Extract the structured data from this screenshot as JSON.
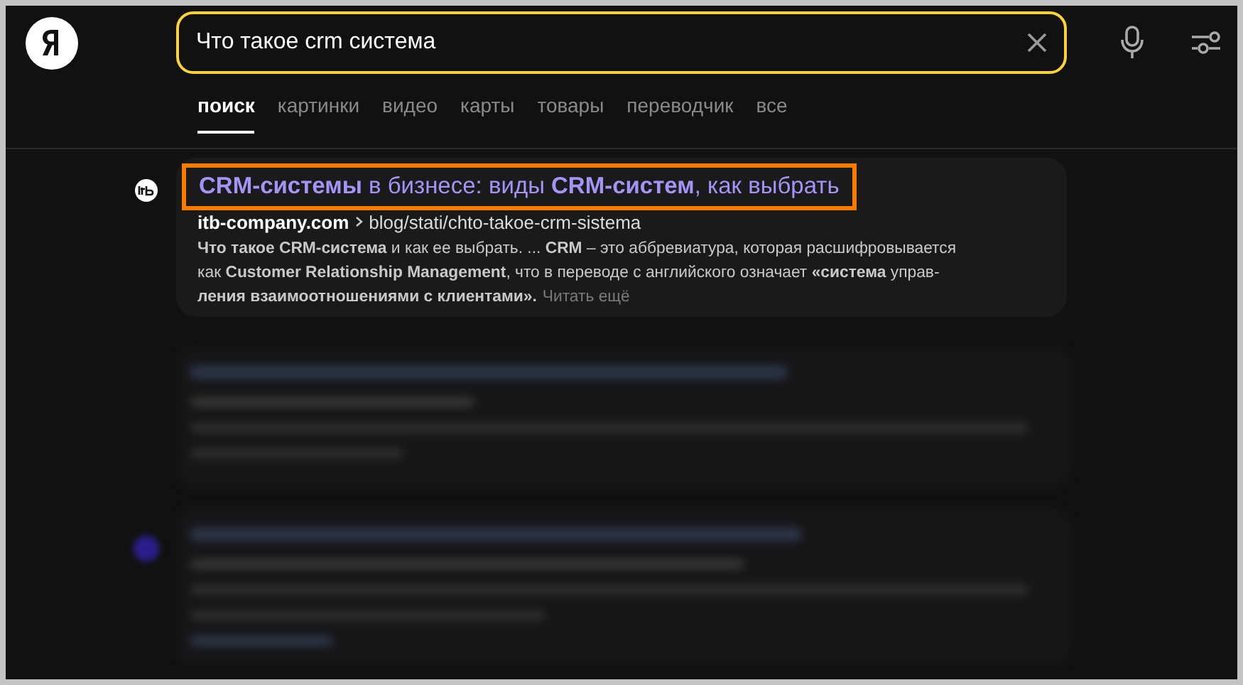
{
  "search": {
    "value": "Что такое crm система"
  },
  "tabs": [
    {
      "label": "поиск",
      "selected": true
    },
    {
      "label": "картинки",
      "selected": false
    },
    {
      "label": "видео",
      "selected": false
    },
    {
      "label": "карты",
      "selected": false
    },
    {
      "label": "товары",
      "selected": false
    },
    {
      "label": "переводчик",
      "selected": false
    },
    {
      "label": "все",
      "selected": false
    }
  ],
  "result": {
    "title": "**CRM-системы** в бизнесе: виды **CRM-систем**, как выбрать",
    "highlighted": true,
    "site": "itb-company.com",
    "path": "blog/stati/chto-takoe-crm-sistema",
    "snippet_lines": [
      "**Что такое CRM-система** и как ее выбрать. ... **CRM** – это аббревиатура, которая расшифровывается",
      "как **Customer Relationship Management**, что в переводе с английского означает **«система** управ-",
      "**ления взаимоотношениями с клиентами».**"
    ],
    "more_link": "Читать ещё"
  }
}
